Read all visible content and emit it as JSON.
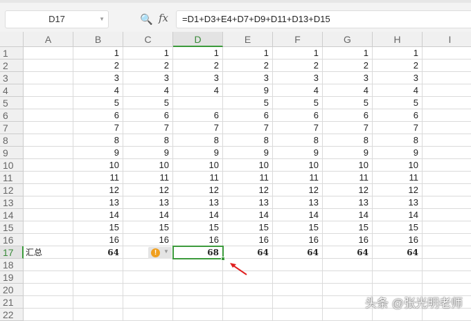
{
  "name_box": "D17",
  "formula": "=D1+D3+E4+D7+D9+D11+D13+D15",
  "fx_label": "fx",
  "columns": [
    "A",
    "B",
    "C",
    "D",
    "E",
    "F",
    "G",
    "H",
    "I"
  ],
  "rows": [
    "1",
    "2",
    "3",
    "4",
    "5",
    "6",
    "7",
    "8",
    "9",
    "10",
    "11",
    "12",
    "13",
    "14",
    "15",
    "16",
    "17",
    "18",
    "19",
    "20",
    "21",
    "22"
  ],
  "cells": {
    "B": [
      "1",
      "2",
      "3",
      "4",
      "5",
      "6",
      "7",
      "8",
      "9",
      "10",
      "11",
      "12",
      "13",
      "14",
      "15",
      "16",
      "64"
    ],
    "C": [
      "1",
      "2",
      "3",
      "4",
      "5",
      "6",
      "7",
      "8",
      "9",
      "10",
      "11",
      "12",
      "13",
      "14",
      "15",
      "16",
      ""
    ],
    "D": [
      "1",
      "2",
      "3",
      "4",
      "",
      "6",
      "7",
      "8",
      "9",
      "10",
      "11",
      "12",
      "13",
      "14",
      "15",
      "16",
      "68"
    ],
    "E": [
      "1",
      "2",
      "3",
      "9",
      "5",
      "6",
      "7",
      "8",
      "9",
      "10",
      "11",
      "12",
      "13",
      "14",
      "15",
      "16",
      "64"
    ],
    "F": [
      "1",
      "2",
      "3",
      "4",
      "5",
      "6",
      "7",
      "8",
      "9",
      "10",
      "11",
      "12",
      "13",
      "14",
      "15",
      "16",
      "64"
    ],
    "G": [
      "1",
      "2",
      "3",
      "4",
      "5",
      "6",
      "7",
      "8",
      "9",
      "10",
      "11",
      "12",
      "13",
      "14",
      "15",
      "16",
      "64"
    ],
    "H": [
      "1",
      "2",
      "3",
      "4",
      "5",
      "6",
      "7",
      "8",
      "9",
      "10",
      "11",
      "12",
      "13",
      "14",
      "15",
      "16",
      "64"
    ]
  },
  "a17_label": "汇总",
  "warning_icon": "!",
  "watermark": "头条 @张光明老师",
  "colors": {
    "selection": "#3c9a3c",
    "arrow": "#e02020",
    "warning": "#f0a020"
  }
}
